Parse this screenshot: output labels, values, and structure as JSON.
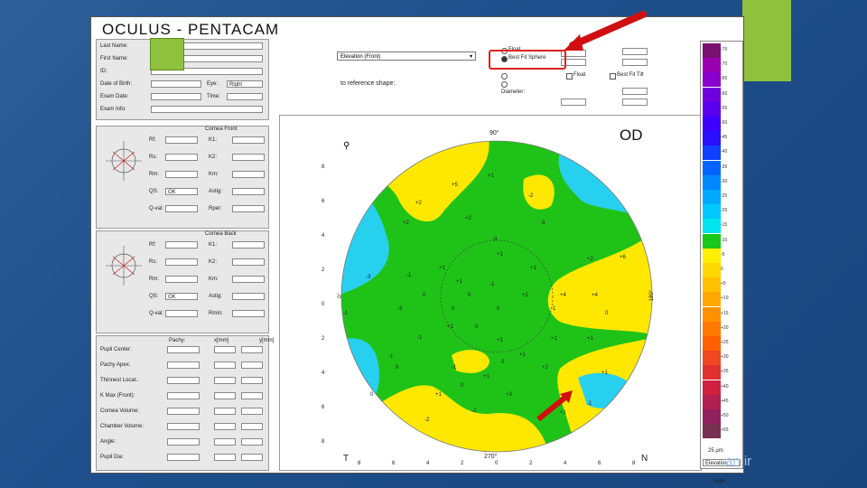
{
  "app": {
    "title": "OCULUS - PENTACAM"
  },
  "watermark": "an.ir",
  "patient": {
    "labels": [
      "Last Name:",
      "First Name:",
      "ID:",
      "Date of Birth:",
      "Exam Date:",
      "Exam Info:"
    ],
    "eye_label": "Eye:",
    "eye_value": "Right",
    "dob_value": "",
    "exam_date_value": "",
    "time_label": "Time:",
    "time_value": ""
  },
  "front": {
    "title": "Cornea Front",
    "rows": [
      {
        "a": "Rf:",
        "av": "",
        "b": "K1:",
        "bv": "",
        "red": false
      },
      {
        "a": "Rs:",
        "av": "",
        "b": "K2:",
        "bv": "",
        "red": true
      },
      {
        "a": "Rm:",
        "av": "",
        "b": "Km:",
        "bv": "",
        "red": false
      },
      {
        "a": "QS:",
        "av": "OK",
        "b": "Astig:",
        "bv": "",
        "red": false
      },
      {
        "a": "Q-val:",
        "av": "",
        "b": "Rper:",
        "bv": "",
        "red": false
      }
    ]
  },
  "back": {
    "title": "Cornea Back",
    "rows": [
      {
        "a": "Rf:",
        "av": "",
        "b": "K1:",
        "bv": "",
        "red": false
      },
      {
        "a": "Rs:",
        "av": "",
        "b": "K2:",
        "bv": "",
        "red": true
      },
      {
        "a": "Rm:",
        "av": "",
        "b": "Km:",
        "bv": "",
        "red": false
      },
      {
        "a": "QS:",
        "av": "OK",
        "b": "Astig:",
        "bv": "",
        "red": false
      },
      {
        "a": "Q-val:",
        "av": "",
        "b": "Rmin:",
        "bv": "",
        "red": false
      }
    ]
  },
  "pachy": {
    "labels": [
      "Pupil Center:",
      "Pachy Apex:",
      "Thinnest Locat.:",
      "K Max (Front):",
      "Cornea Volume:",
      "Chamber Volume:",
      "Angle:",
      "Pupil Dia:"
    ],
    "col_headers": [
      "Pachy:",
      "x[mm]",
      "y[mm]"
    ]
  },
  "map": {
    "type_select": "Elevation (Front)",
    "ref_label": "to reference shape:",
    "options": {
      "float": "Float",
      "fit": "Best Fit Sphere",
      "fit_tilt": "Best Fit Tilt"
    },
    "diameter_label": "Diameter:",
    "eye_code": "OD",
    "top_angle": "90°",
    "bottom_angle": "270°",
    "left_letter": "T",
    "right_letter": "N",
    "left_angle": "0°",
    "right_angle": "180°",
    "y_ticks": [
      "8",
      "6",
      "4",
      "2",
      "0",
      "2",
      "4",
      "6",
      "8"
    ],
    "x_ticks": [
      "8",
      "6",
      "4",
      "2",
      "0",
      "2",
      "4",
      "6",
      "8"
    ],
    "contour_labels": [
      "+1",
      "+5",
      "+2",
      "+2",
      "+2",
      "-3",
      "-2",
      "-3",
      "+1",
      "+1",
      "+1",
      "-1",
      "+2",
      "+6",
      "+1",
      "-3",
      "-1",
      "0",
      "0",
      "+2",
      "+4",
      "-3",
      "-1",
      "0",
      "0",
      "-1",
      "0",
      "+4",
      "+1",
      "0",
      "+1",
      "+1",
      "+1",
      "-1",
      "+1",
      "0",
      "0",
      "-1",
      "+2",
      "+1",
      "0",
      "+1",
      "0",
      "+3",
      "-2",
      "+1",
      "-1",
      "-2",
      "+1",
      "-1"
    ]
  },
  "scale": {
    "swatch_colors": [
      "#7a1070",
      "#9a00b0",
      "#8800cc",
      "#7000dd",
      "#5a00ee",
      "#4000ff",
      "#2a10ff",
      "#1040ff",
      "#0064ff",
      "#0088ff",
      "#00a8ff",
      "#00c8ff",
      "#00e4f0",
      "#19c818",
      "#ffef00",
      "#ffd800",
      "#ffc000",
      "#ffa800",
      "#ff9000",
      "#ff7800",
      "#ff6000",
      "#f04820",
      "#e03030",
      "#d02040",
      "#b02050",
      "#902060",
      "#783050"
    ],
    "values": [
      "-75",
      "-70",
      "-65",
      "-60",
      "-55",
      "-50",
      "-45",
      "-40",
      "-35",
      "-30",
      "-25",
      "-20",
      "-15",
      "-10",
      "-5",
      "0",
      "+5",
      "+10",
      "+15",
      "+20",
      "+25",
      "+30",
      "+35",
      "+40",
      "+45",
      "+50",
      "+55"
    ],
    "unit": "25 µm",
    "name": "Elevation",
    "sight": "Sight"
  }
}
